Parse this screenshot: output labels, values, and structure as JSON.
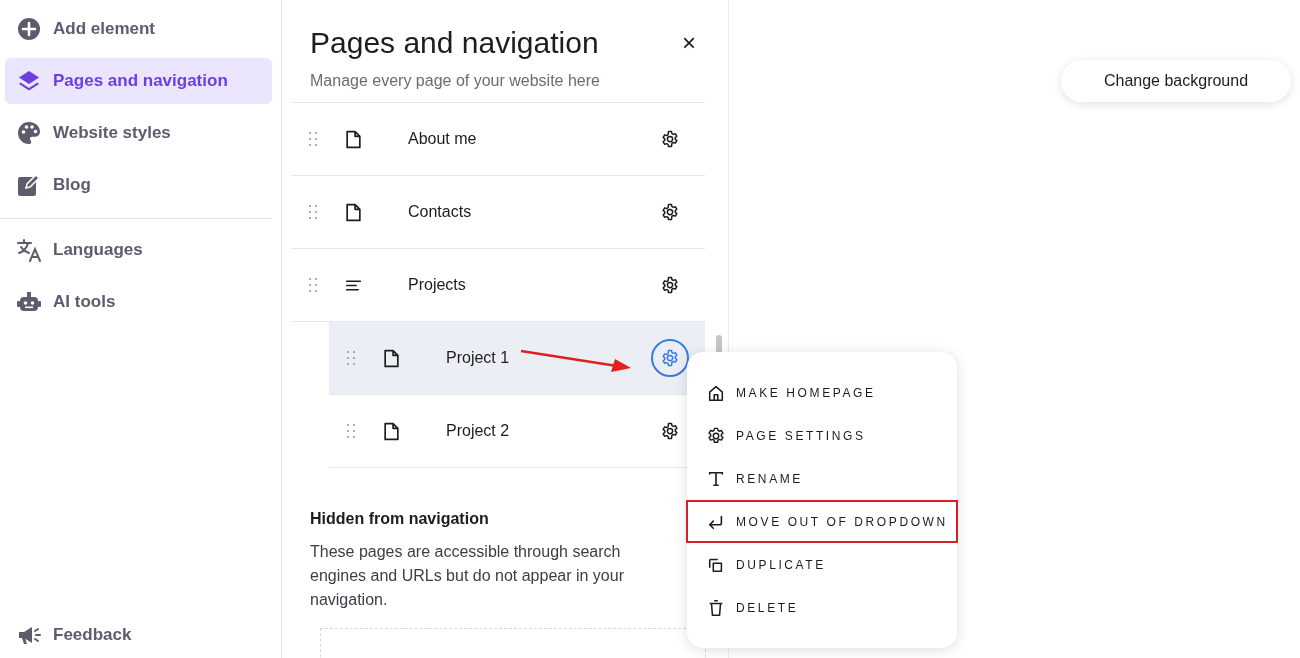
{
  "sidebar": {
    "groups": [
      [
        {
          "label": "Add element",
          "selected": false
        },
        {
          "label": "Pages and navigation",
          "selected": true
        },
        {
          "label": "Website styles",
          "selected": false
        },
        {
          "label": "Blog",
          "selected": false
        }
      ],
      [
        {
          "label": "Languages",
          "selected": false
        },
        {
          "label": "AI tools",
          "selected": false
        }
      ]
    ],
    "footer": {
      "label": "Feedback"
    }
  },
  "panel": {
    "title": "Pages and navigation",
    "close": "×",
    "subtitle": "Manage every page of your website here",
    "pages": [
      {
        "label": "About me",
        "kind": "page",
        "selected": false,
        "focused": false
      },
      {
        "label": "Contacts",
        "kind": "page",
        "selected": false,
        "focused": false
      },
      {
        "label": "Projects",
        "kind": "dropdown",
        "selected": false,
        "focused": false,
        "children": [
          {
            "label": "Project 1",
            "kind": "page",
            "selected": true,
            "focused": true
          },
          {
            "label": "Project 2",
            "kind": "page",
            "selected": false,
            "focused": false
          }
        ]
      }
    ],
    "hidden": {
      "heading": "Hidden from navigation",
      "text": "These pages are accessible through search engines and URLs but do not appear in your navigation."
    }
  },
  "context_menu": [
    {
      "label": "MAKE HOMEPAGE",
      "kind": "home",
      "highlighted": false
    },
    {
      "label": "PAGE SETTINGS",
      "kind": "settings",
      "highlighted": false
    },
    {
      "label": "RENAME",
      "kind": "rename",
      "highlighted": false
    },
    {
      "label": "MOVE OUT OF DROPDOWN",
      "kind": "move-out",
      "highlighted": true
    },
    {
      "label": "DUPLICATE",
      "kind": "duplicate",
      "highlighted": false
    },
    {
      "label": "DELETE",
      "kind": "delete",
      "highlighted": false
    }
  ],
  "change_background": "Change background"
}
